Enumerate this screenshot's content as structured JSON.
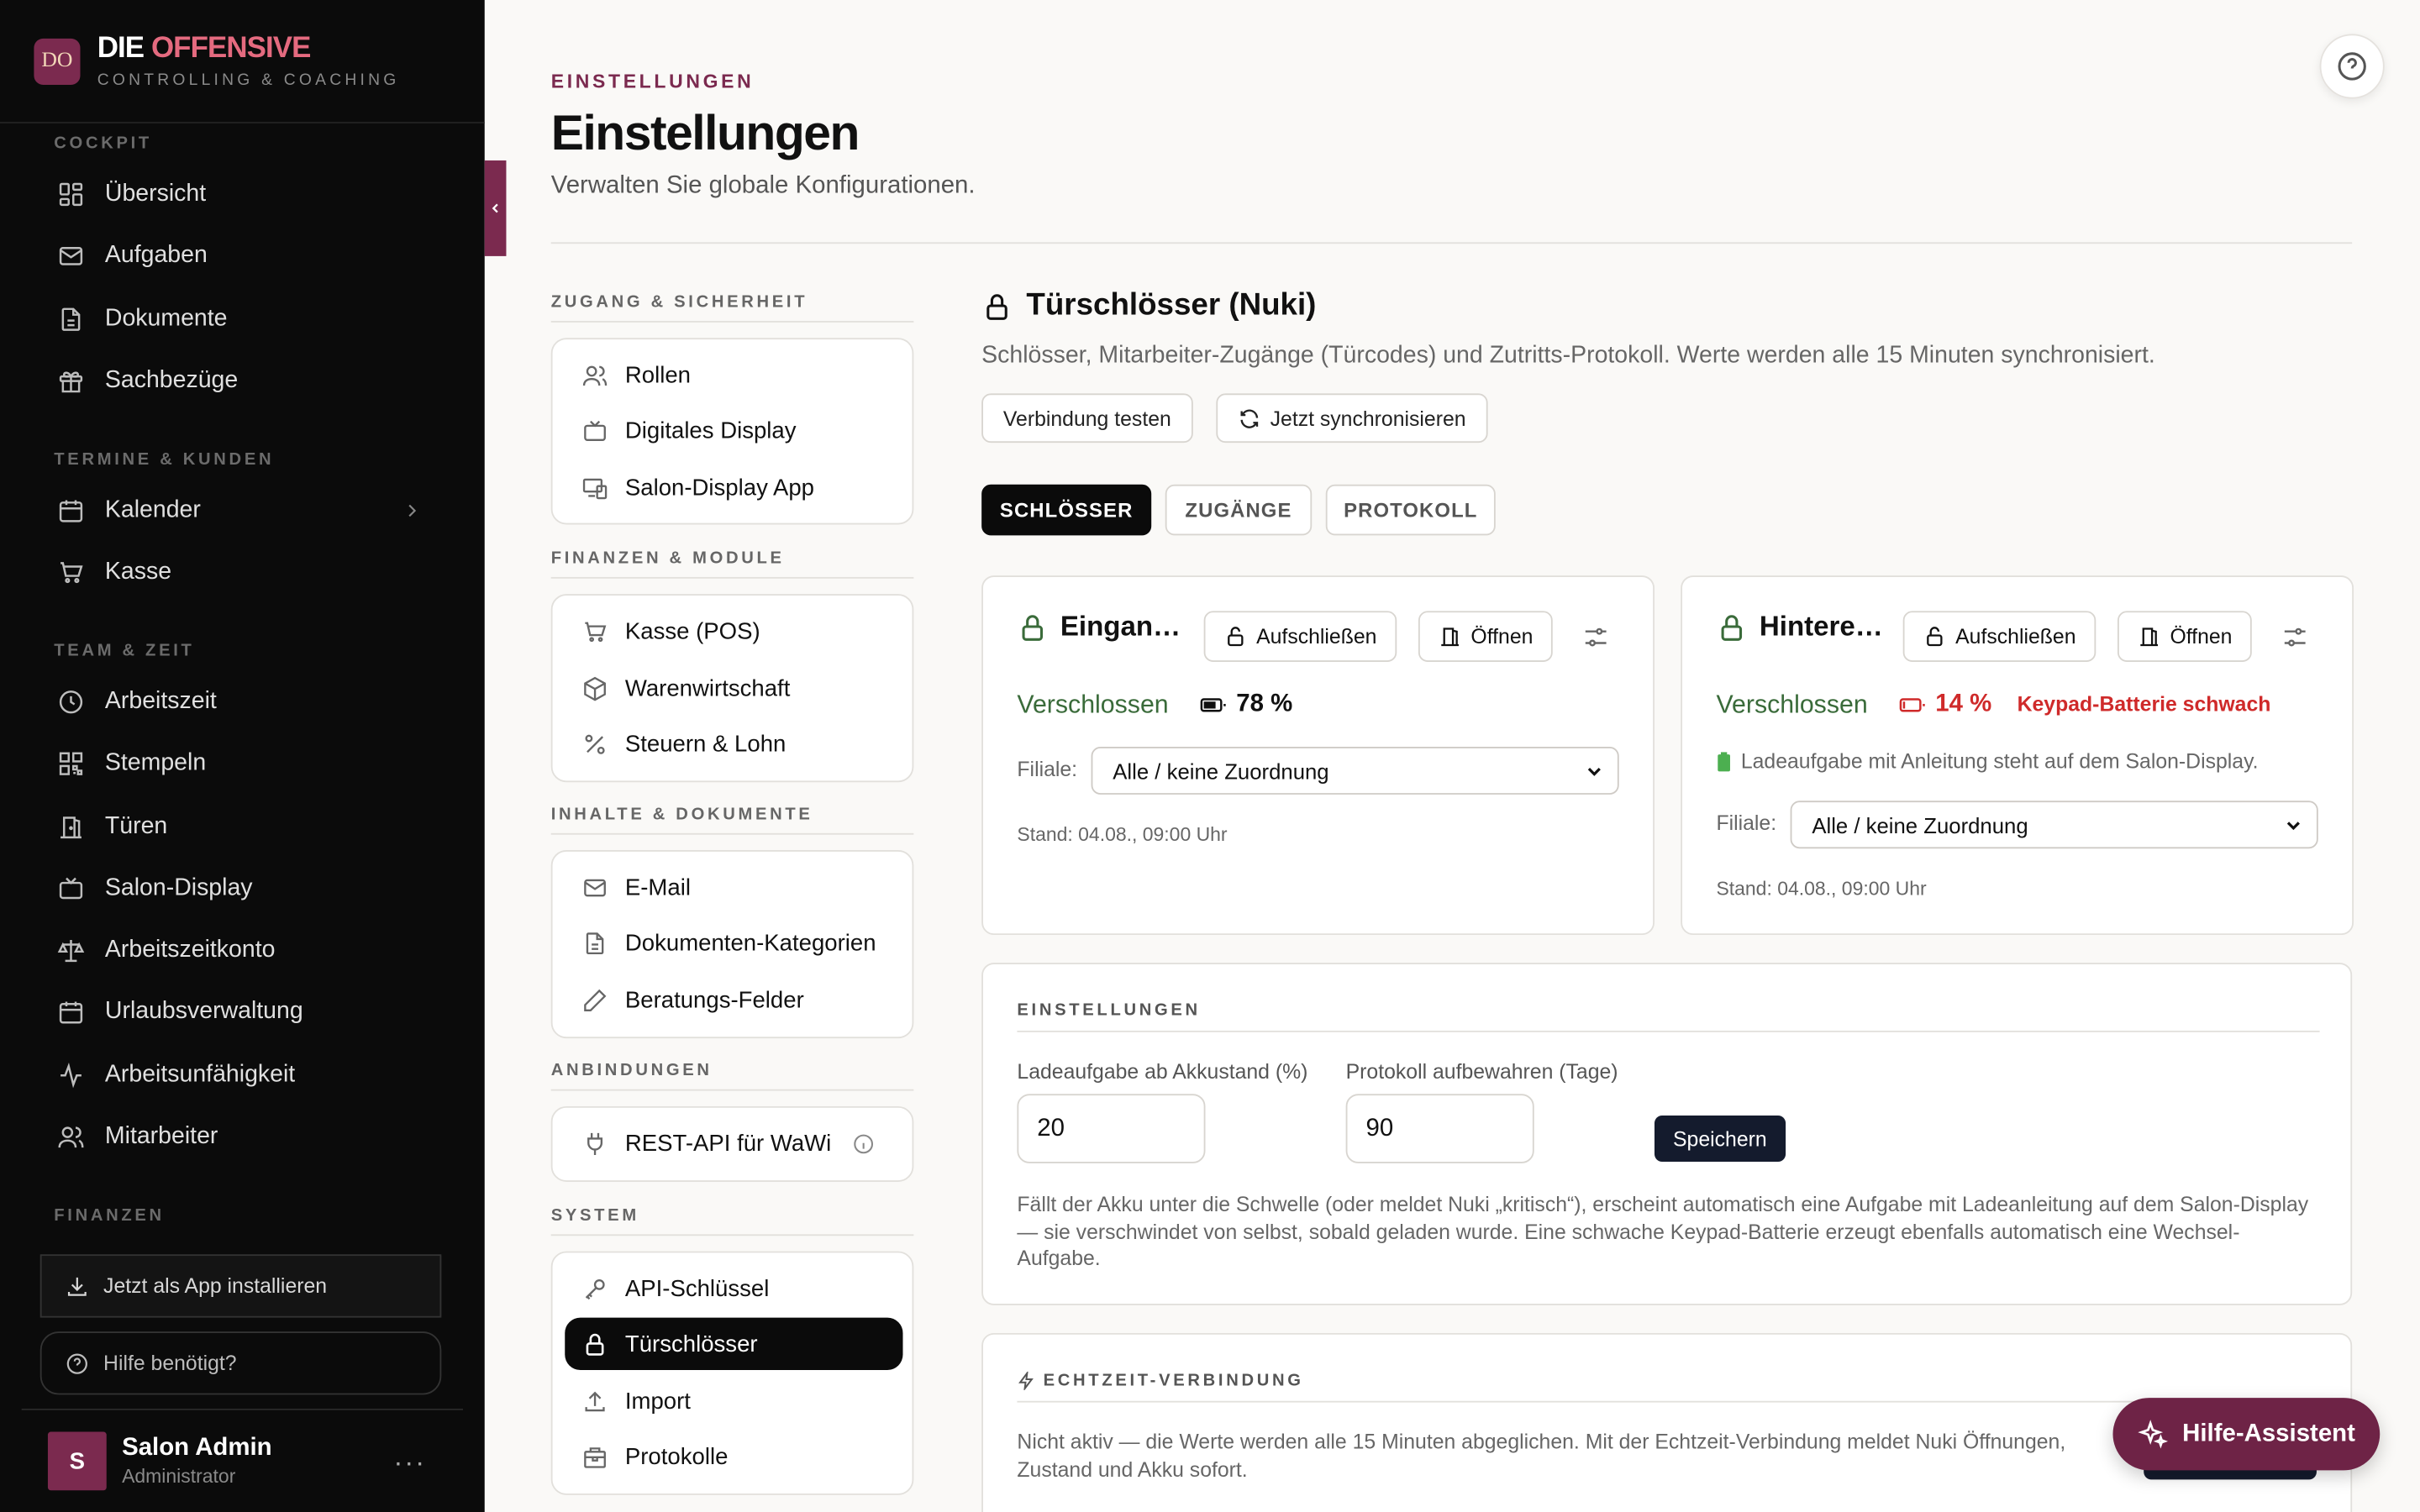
{
  "brand": {
    "logo": "DO",
    "name_part1": "DIE",
    "name_part2": "OFFENSIVE",
    "subtitle": "CONTROLLING & COACHING"
  },
  "sidebar": {
    "sections": [
      "COCKPIT",
      "TERMINE & KUNDEN",
      "TEAM & ZEIT",
      "FINANZEN"
    ],
    "items": [
      {
        "label": "Übersicht",
        "icon": "dashboard-icon"
      },
      {
        "label": "Aufgaben",
        "icon": "mail-icon"
      },
      {
        "label": "Dokumente",
        "icon": "document-icon"
      },
      {
        "label": "Sachbezüge",
        "icon": "gift-icon"
      },
      {
        "label": "Kalender",
        "icon": "calendar-icon"
      },
      {
        "label": "Kasse",
        "icon": "cart-icon"
      },
      {
        "label": "Arbeitszeit",
        "icon": "clock-icon"
      },
      {
        "label": "Stempeln",
        "icon": "qr-icon"
      },
      {
        "label": "Türen",
        "icon": "door-icon"
      },
      {
        "label": "Salon-Display",
        "icon": "tv-icon"
      },
      {
        "label": "Arbeitszeitkonto",
        "icon": "scale-icon"
      },
      {
        "label": "Urlaubsverwaltung",
        "icon": "calendar-icon"
      },
      {
        "label": "Arbeitsunfähigkeit",
        "icon": "activity-icon"
      },
      {
        "label": "Mitarbeiter",
        "icon": "users-icon"
      }
    ],
    "install_label": "Jetzt als App installieren",
    "help_label": "Hilfe benötigt?",
    "user": {
      "initial": "S",
      "name": "Salon Admin",
      "role": "Administrator",
      "more": "···"
    }
  },
  "header": {
    "eyebrow": "EINSTELLUNGEN",
    "title": "Einstellungen",
    "subtitle": "Verwalten Sie globale Konfigurationen."
  },
  "settings_nav": {
    "sections": [
      "ZUGANG & SICHERHEIT",
      "FINANZEN & MODULE",
      "INHALTE & DOKUMENTE",
      "ANBINDUNGEN",
      "SYSTEM"
    ],
    "items": [
      {
        "label": "Rollen",
        "icon": "users-icon"
      },
      {
        "label": "Digitales Display",
        "icon": "tv-icon"
      },
      {
        "label": "Salon-Display App",
        "icon": "devices-icon"
      },
      {
        "label": "Kasse (POS)",
        "icon": "cart-icon"
      },
      {
        "label": "Warenwirtschaft",
        "icon": "box-icon"
      },
      {
        "label": "Steuern & Lohn",
        "icon": "percent-icon"
      },
      {
        "label": "E-Mail",
        "icon": "mail-icon"
      },
      {
        "label": "Dokumenten-Kategorien",
        "icon": "document-icon"
      },
      {
        "label": "Beratungs-Felder",
        "icon": "pencil-icon"
      },
      {
        "label": "REST-API für WaWi",
        "icon": "plug-icon"
      },
      {
        "label": "API-Schlüssel",
        "icon": "key-icon"
      },
      {
        "label": "Türschlösser",
        "icon": "lock-icon",
        "active": true
      },
      {
        "label": "Import",
        "icon": "upload-icon"
      },
      {
        "label": "Protokolle",
        "icon": "archive-icon"
      }
    ]
  },
  "section": {
    "title": "Türschlösser (Nuki)",
    "description": "Schlösser, Mitarbeiter-Zugänge (Türcodes) und Zutritts-Protokoll. Werte werden alle 15 Minuten synchronisiert.",
    "test_button": "Verbindung testen",
    "sync_button": "Jetzt synchronisieren",
    "tabs": [
      "SCHLÖSSER",
      "ZUGÄNGE",
      "PROTOKOLL"
    ],
    "active_tab": "SCHLÖSSER"
  },
  "locks": [
    {
      "name": "Eingan…",
      "unlock": "Aufschließen",
      "open": "Öffnen",
      "status": "Verschlossen",
      "battery": "78 %",
      "battery_level": 0.78,
      "warning": "",
      "hint": "",
      "filiale_label": "Filiale:",
      "filiale_value": "Alle / keine Zuordnung",
      "stand": "Stand: 04.08., 09:00 Uhr"
    },
    {
      "name": "Hintere…",
      "unlock": "Aufschließen",
      "open": "Öffnen",
      "status": "Verschlossen",
      "battery": "14 %",
      "battery_level": 0.14,
      "warning": "Keypad-Batterie schwach",
      "hint": "Ladeaufgabe mit Anleitung steht auf dem Salon-Display.",
      "filiale_label": "Filiale:",
      "filiale_value": "Alle / keine Zuordnung",
      "stand": "Stand: 04.08., 09:00 Uhr"
    }
  ],
  "settings_card": {
    "title": "EINSTELLUNGEN",
    "field1_label": "Ladeaufgabe ab Akkustand (%)",
    "field1_value": "20",
    "field2_label": "Protokoll aufbewahren (Tage)",
    "field2_value": "90",
    "save_label": "Speichern",
    "note": "Fällt der Akku unter die Schwelle (oder meldet Nuki „kritisch“), erscheint automatisch eine Aufgabe mit Ladeanleitung auf dem Salon-Display — sie verschwindet von selbst, sobald geladen wurde. Eine schwache Keypad-Batterie erzeugt ebenfalls automatisch eine Wechsel-Aufgabe."
  },
  "realtime_card": {
    "title": "ECHTZEIT-VERBINDUNG",
    "note": "Nicht aktiv — die Werte werden alle 15 Minuten abgeglichen. Mit der Echtzeit-Verbindung meldet Nuki Öffnungen, Zustand und Akku sofort."
  },
  "assistant_label": "Hilfe-Assistent",
  "colors": {
    "accent": "#7b2a4f",
    "success": "#3a6b3a",
    "danger": "#cf2a2a",
    "dark": "#0b0b0b"
  }
}
